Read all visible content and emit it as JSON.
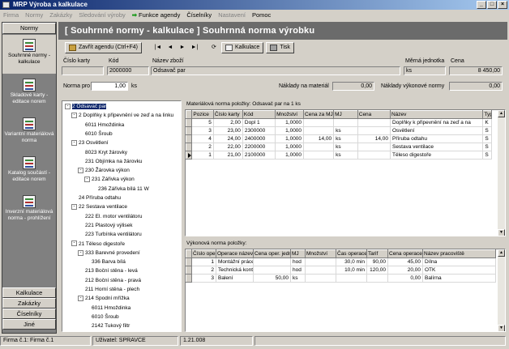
{
  "window": {
    "title": "MRP Výroba a kalkulace",
    "min": "_",
    "max": "□",
    "close": "×"
  },
  "menu": [
    {
      "label": "Firma",
      "disabled": true
    },
    {
      "label": "Normy",
      "disabled": true
    },
    {
      "label": "Zakázky",
      "disabled": true
    },
    {
      "label": "Sledování výroby",
      "disabled": true
    },
    {
      "label": "Funkce agendy",
      "disabled": false
    },
    {
      "label": "Číselníky",
      "disabled": false
    },
    {
      "label": "Nastavení",
      "disabled": true
    },
    {
      "label": "Pomoc",
      "disabled": false
    }
  ],
  "sidebar": {
    "header": "Normy",
    "items": [
      {
        "label": "Souhrnné normy - kalkulace",
        "active": true
      },
      {
        "label": "Skladové karty - editace norem",
        "active": false
      },
      {
        "label": "Variantní materiálová norma",
        "active": false
      },
      {
        "label": "Katalog součástí - editace norem",
        "active": false
      },
      {
        "label": "Inverzní materiálová norma - prohlížení",
        "active": false
      }
    ],
    "bottom": [
      "Kalkulace",
      "Zakázky",
      "Číselníky",
      "Jiné"
    ]
  },
  "header": {
    "title": "[ Souhrnné normy - kalkulace  ] Souhrnná norma výrobku"
  },
  "toolbar": {
    "close_label": "Zavřít agendu (Ctrl+F4)",
    "nav": [
      "|◄",
      "◄",
      "►",
      "►|",
      "⟳"
    ],
    "kalkulace_label": "Kalkulace",
    "tisk_label": "Tisk"
  },
  "form": {
    "cislo_karty_label": "Číslo karty",
    "cislo_karty": "",
    "kod_label": "Kód",
    "kod": "2000000",
    "nazev_label": "Název zboží",
    "nazev": "Odsavač par",
    "mj_label": "Měrná jednotka",
    "mj": "ks",
    "cena_label": "Cena",
    "cena": "8 450,00",
    "norma_pro_label": "Norma pro",
    "norma_pro": "1,00",
    "norma_pro_unit": "ks",
    "naklady_mat_label": "Náklady na materiál",
    "naklady_mat": "0,00",
    "naklady_vyk_label": "Náklady výkonové normy",
    "naklady_vyk": "0,00"
  },
  "tree": [
    {
      "text": "2 Odsavač par",
      "level": 0,
      "pm": "-",
      "sel": true
    },
    {
      "text": "2 Doplňky k připevnění ve zeď a na linku",
      "level": 1,
      "pm": "-"
    },
    {
      "text": "6011 Hmoždinka",
      "level": 2
    },
    {
      "text": "6010 Šroub",
      "level": 2
    },
    {
      "text": "23 Osvětlení",
      "level": 1,
      "pm": "-"
    },
    {
      "text": "8023 Kryt žárovky",
      "level": 2
    },
    {
      "text": "231 Objímka na žárovku",
      "level": 2
    },
    {
      "text": "230 Žárovka výkon",
      "level": 2,
      "pm": "-"
    },
    {
      "text": "231 Zářivka výkon",
      "level": 3,
      "pm": "-"
    },
    {
      "text": "236 Zářivka bílá 11 W",
      "level": 4
    },
    {
      "text": "24 Příruba odtahu",
      "level": 1
    },
    {
      "text": "22 Sestava ventilace",
      "level": 1,
      "pm": "-"
    },
    {
      "text": "222 El. motor ventilátoru",
      "level": 2
    },
    {
      "text": "221 Plastový výlisek",
      "level": 2
    },
    {
      "text": "223 Turbínka ventilátoru",
      "level": 2
    },
    {
      "text": "21 Těleso digestoře",
      "level": 1,
      "pm": "-"
    },
    {
      "text": "333 Barevné provedení",
      "level": 2,
      "pm": "-"
    },
    {
      "text": "336 Barva bílá",
      "level": 3
    },
    {
      "text": "213 Boční stěna - levá",
      "level": 2
    },
    {
      "text": "212 Boční stěna - pravá",
      "level": 2
    },
    {
      "text": "211 Horní stěna - plech",
      "level": 2
    },
    {
      "text": "214 Spodní mřížka",
      "level": 2,
      "pm": "-"
    },
    {
      "text": "6011 Hmoždinka",
      "level": 3
    },
    {
      "text": "6010 Šroub",
      "level": 3
    },
    {
      "text": "2142 Tukový filtr",
      "level": 3
    }
  ],
  "mat": {
    "title": "Materiálová norma položky:  Odsavač par na 1 ks",
    "columns": [
      "Pozice",
      "Číslo karty",
      "Kód",
      "Množství",
      "Cena za MJ",
      "MJ",
      "Cena",
      "Název",
      "Typ"
    ],
    "rows": [
      [
        "5",
        "2,00",
        "Dopl 1",
        "1,0000",
        "",
        "",
        "",
        "Doplňky k připevnění na zeď a na",
        "K"
      ],
      [
        "3",
        "23,00",
        "2300000",
        "1,0000",
        "",
        "ks",
        "",
        "Osvětlení",
        "S"
      ],
      [
        "4",
        "24,00",
        "2400000",
        "1,0000",
        "14,00",
        "ks",
        "14,00",
        "Příruba odtahu",
        "S"
      ],
      [
        "2",
        "22,00",
        "2200000",
        "1,0000",
        "",
        "ks",
        "",
        "Sestava ventilace",
        "S"
      ],
      [
        "1",
        "21,00",
        "2100000",
        "1,0000",
        "",
        "ks",
        "",
        "Těleso digestoře",
        "S"
      ]
    ]
  },
  "vyk": {
    "title": "Výkonová norma položky:",
    "columns": [
      "Číslo oper",
      "Operace název",
      "Cena oper. jedn",
      "MJ",
      "Množství",
      "Čas operace",
      "Tarif",
      "Cena operace",
      "Název pracoviště"
    ],
    "rows": [
      [
        "1",
        "Montážní práce",
        "",
        "hod",
        "",
        "30,0 min",
        "90,00",
        "45,00",
        "Dílna"
      ],
      [
        "2",
        "Technická kont",
        "",
        "hod",
        "",
        "10,0 min",
        "120,00",
        "20,00",
        "OTK"
      ],
      [
        "3",
        "Balení",
        "50,00",
        "ks",
        "",
        "",
        "",
        "0,00",
        "Balírna"
      ]
    ]
  },
  "status": {
    "firma": "Firma č.1: Firma č.1",
    "uzivatel": "Uživatel: SPRAVCE",
    "datum": "1.21.008"
  }
}
